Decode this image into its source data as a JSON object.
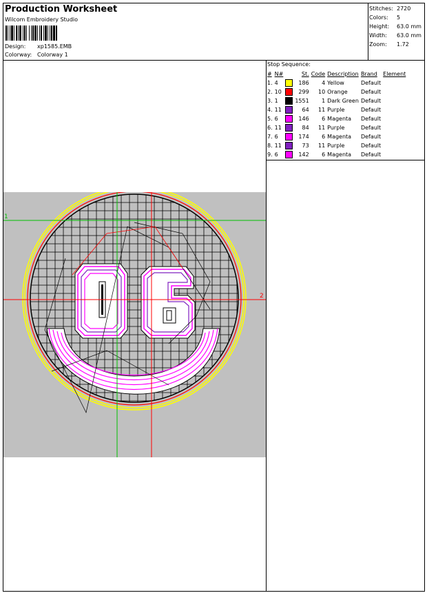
{
  "header": {
    "title": "Production Worksheet",
    "studio": "Wilcom Embroidery Studio",
    "design_label": "Design:",
    "design_value": "xp1585.EMB",
    "colorway_label": "Colorway:",
    "colorway_value": "Colorway 1"
  },
  "stats": [
    {
      "label": "Stitches:",
      "value": "2720"
    },
    {
      "label": "Colors:",
      "value": "5"
    },
    {
      "label": "Height:",
      "value": "63.0 mm"
    },
    {
      "label": "Width:",
      "value": "63.0 mm"
    },
    {
      "label": "Zoom:",
      "value": "1.72"
    }
  ],
  "sequence": {
    "title": "Stop Sequence:",
    "columns": [
      "#",
      "N#",
      "",
      "St.",
      "Code",
      "Description",
      "Brand",
      "Element"
    ],
    "rows": [
      {
        "idx": "1.",
        "n": "4",
        "color": "#ffff00",
        "st": "186",
        "code": "4",
        "desc": "Yellow",
        "brand": "Default"
      },
      {
        "idx": "2.",
        "n": "10",
        "color": "#ff0000",
        "st": "299",
        "code": "10",
        "desc": "Orange",
        "brand": "Default"
      },
      {
        "idx": "3.",
        "n": "1",
        "color": "#000000",
        "st": "1551",
        "code": "1",
        "desc": "Dark Green",
        "brand": "Default"
      },
      {
        "idx": "4.",
        "n": "11",
        "color": "#8020c0",
        "st": "64",
        "code": "11",
        "desc": "Purple",
        "brand": "Default"
      },
      {
        "idx": "5.",
        "n": "6",
        "color": "#ff00ff",
        "st": "146",
        "code": "6",
        "desc": "Magenta",
        "brand": "Default"
      },
      {
        "idx": "6.",
        "n": "11",
        "color": "#8020c0",
        "st": "84",
        "code": "11",
        "desc": "Purple",
        "brand": "Default"
      },
      {
        "idx": "7.",
        "n": "6",
        "color": "#ff00ff",
        "st": "174",
        "code": "6",
        "desc": "Magenta",
        "brand": "Default"
      },
      {
        "idx": "8.",
        "n": "11",
        "color": "#8020c0",
        "st": "73",
        "code": "11",
        "desc": "Purple",
        "brand": "Default"
      },
      {
        "idx": "9.",
        "n": "6",
        "color": "#ff00ff",
        "st": "142",
        "code": "6",
        "desc": "Magenta",
        "brand": "Default"
      }
    ]
  },
  "preview": {
    "marker_1": "1",
    "marker_2": "2",
    "colors": {
      "background": "#c0c0c0",
      "grid": "#000000",
      "rings_yellow": "#ffff00",
      "ring_red": "#ff0000",
      "fill": "#ff00ff",
      "guide_green": "#00c000",
      "guide_red": "#ff0000"
    }
  }
}
